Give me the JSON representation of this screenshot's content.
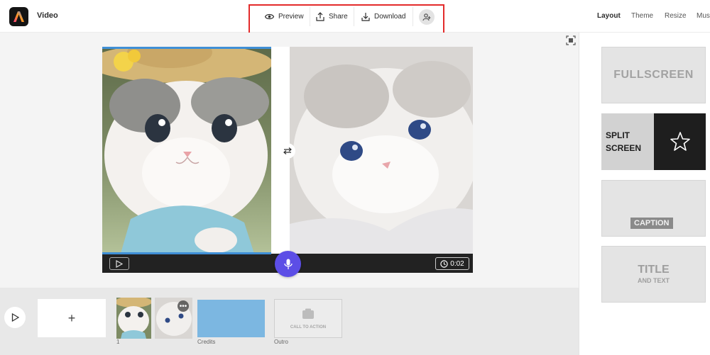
{
  "app": {
    "title": "Video"
  },
  "toolbar": {
    "preview_label": "Preview",
    "share_label": "Share",
    "download_label": "Download"
  },
  "right_tabs": [
    {
      "label": "Layout",
      "active": true
    },
    {
      "label": "Theme"
    },
    {
      "label": "Resize"
    },
    {
      "label": "Musi"
    }
  ],
  "player": {
    "duration": "0:02"
  },
  "timeline": {
    "add_label": "+",
    "clips": [
      {
        "label": "1"
      },
      {
        "label": ""
      },
      {
        "label": "Credits"
      },
      {
        "label": "Outro",
        "text": "CALL TO ACTION"
      }
    ]
  },
  "layouts": {
    "fullscreen": "FULLSCREEN",
    "split": "SPLIT\nSCREEN",
    "caption": "CAPTION",
    "title_main": "TITLE",
    "title_sub": "AND TEXT"
  },
  "colors": {
    "accent_mic": "#5c4ee6",
    "highlight": "#e32b2b",
    "progress": "#3f8fd6",
    "credits_bg": "#7cb7e1"
  }
}
